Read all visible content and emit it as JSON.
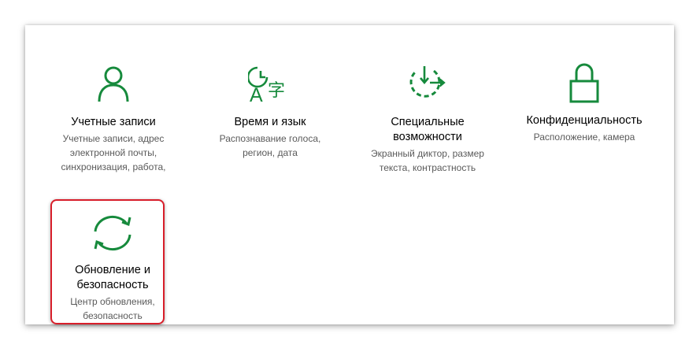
{
  "accent_color": "#168a3c",
  "highlight_color": "#d81e2a",
  "tiles": [
    {
      "icon": "person-icon",
      "title": "Учетные записи",
      "desc_lines": [
        "Учетные записи, адрес",
        "электронной почты,",
        "синхронизация, работа,"
      ]
    },
    {
      "icon": "time-language-icon",
      "title": "Время и язык",
      "desc_lines": [
        "Распознавание голоса,",
        "регион, дата"
      ]
    },
    {
      "icon": "ease-of-access-icon",
      "title_lines": [
        "Специальные",
        "возможности"
      ],
      "desc_lines": [
        "Экранный диктор, размер",
        "текста, контрастность"
      ]
    },
    {
      "icon": "lock-icon",
      "title": "Конфиденциальность",
      "desc_lines": [
        "Расположение, камера"
      ]
    },
    {
      "icon": "sync-icon",
      "title_lines": [
        "Обновление и",
        "безопасность"
      ],
      "desc_lines": [
        "Центр обновления,",
        "безопасность"
      ]
    }
  ]
}
